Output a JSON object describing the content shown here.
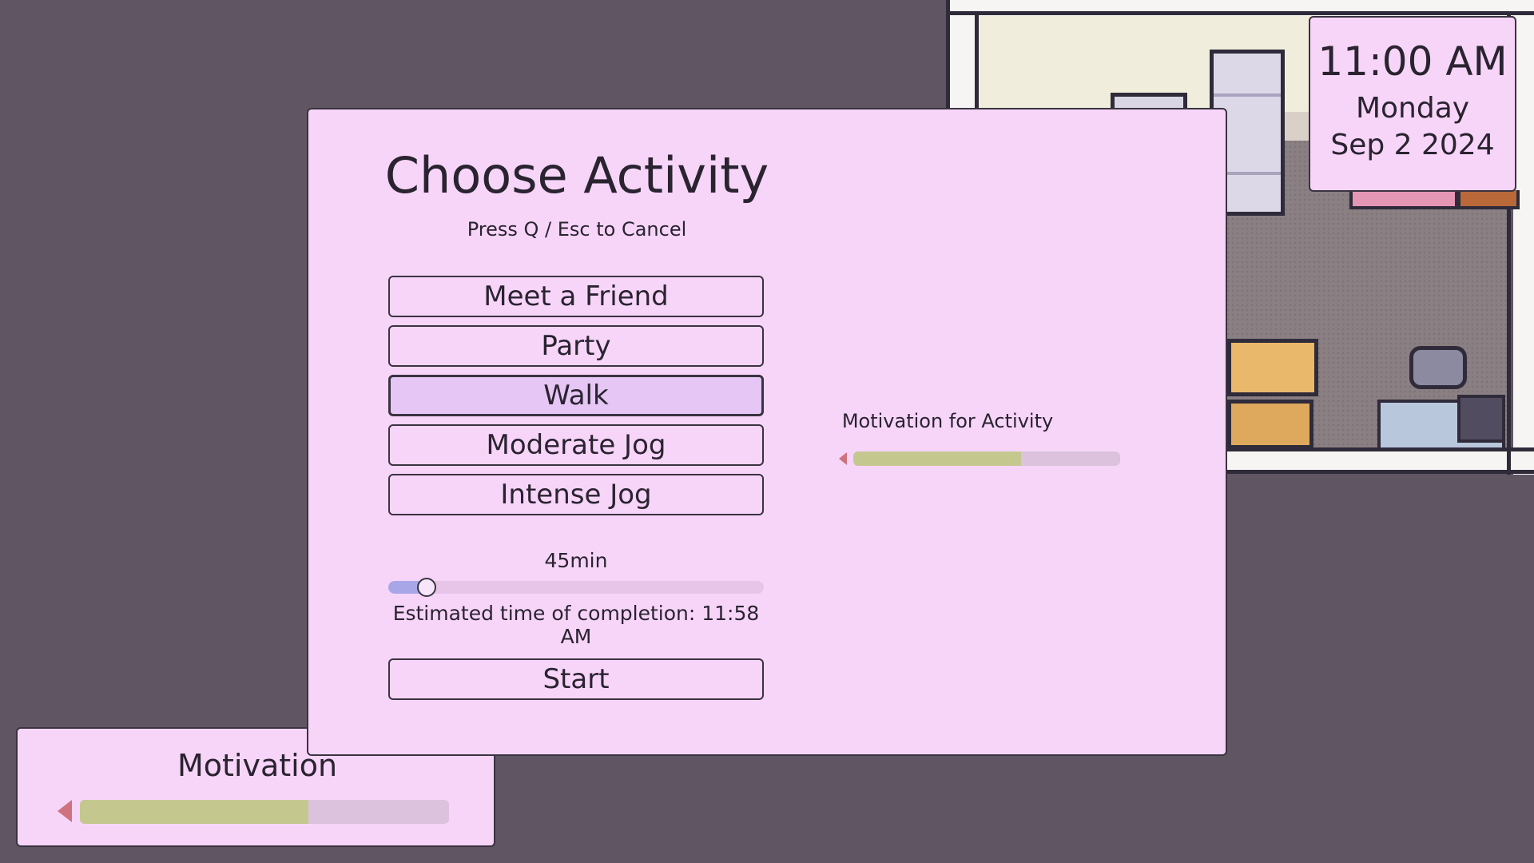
{
  "clock": {
    "time": "11:00 AM",
    "day": "Monday",
    "date": "Sep 2 2024"
  },
  "hud": {
    "motivation_label": "Motivation",
    "motivation_level": 0.62
  },
  "modal": {
    "title": "Choose Activity",
    "hint": "Press Q / Esc to Cancel",
    "activities": [
      {
        "label": "Meet a Friend",
        "selected": false
      },
      {
        "label": "Party",
        "selected": false
      },
      {
        "label": "Walk",
        "selected": true
      },
      {
        "label": "Moderate Jog",
        "selected": false
      },
      {
        "label": "Intense Jog",
        "selected": false
      }
    ],
    "duration_label": "45min",
    "duration_level": 0.1,
    "eta": "Estimated time of completion: 11:58 AM",
    "start_label": "Start",
    "activity_motivation_label": "Motivation for Activity",
    "activity_motivation_level": 0.63
  },
  "colors": {
    "panel_bg": "#f7d5f9",
    "background": "#5f5563",
    "bar_fill": "#c4c88f",
    "slider_fill": "#a8a6e6",
    "selected_bg": "#e5c6f4",
    "arrow": "#cf7280"
  }
}
